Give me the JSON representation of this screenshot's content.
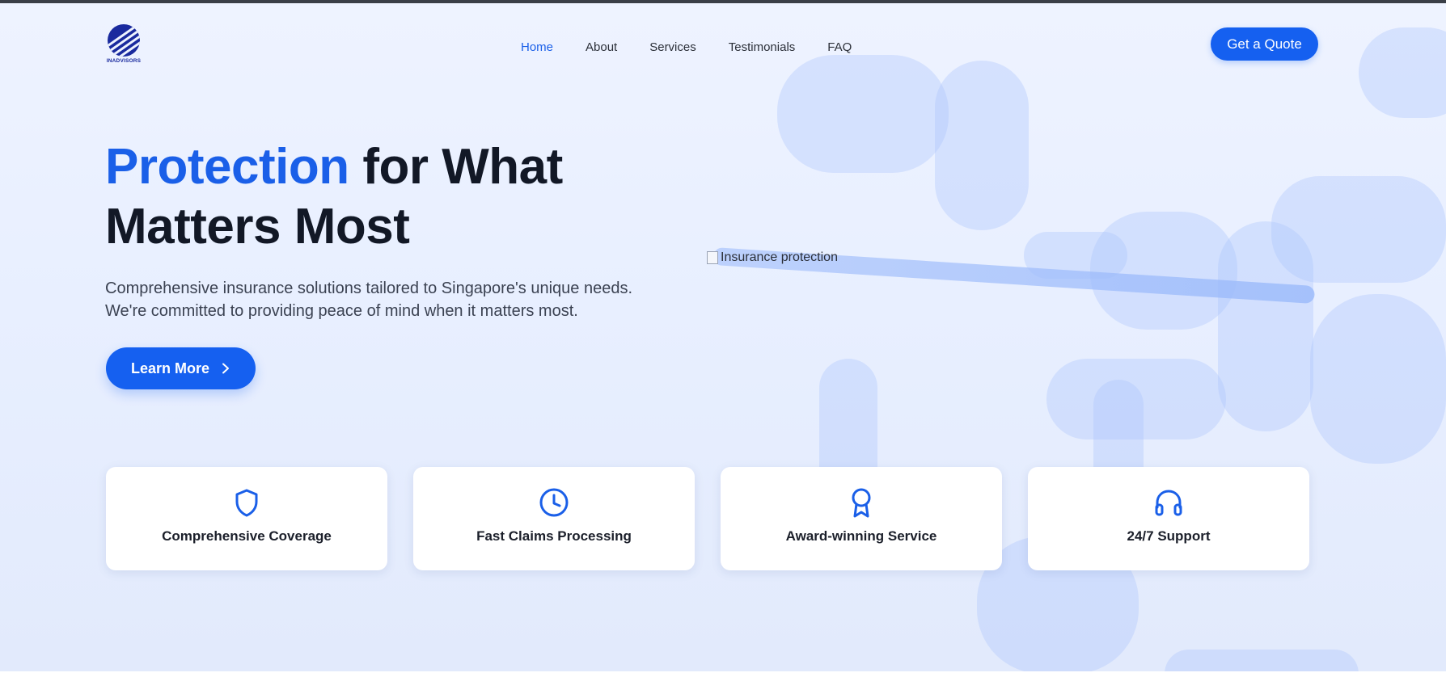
{
  "colors": {
    "accent": "#1a5fe8",
    "button": "#1560f0",
    "heading": "#121826",
    "body_text": "#3b4252",
    "hero_background": "#eef3ff"
  },
  "logo": {
    "text": "INADVISORS",
    "icon": "globe-logo-icon"
  },
  "nav": {
    "items": [
      {
        "label": "Home",
        "active": true
      },
      {
        "label": "About",
        "active": false
      },
      {
        "label": "Services",
        "active": false
      },
      {
        "label": "Testimonials",
        "active": false
      },
      {
        "label": "FAQ",
        "active": false
      }
    ],
    "cta_label": "Get a Quote"
  },
  "hero": {
    "headline_accent": "Protection",
    "headline_line1_rest": " for What",
    "headline_line2": "Matters Most",
    "subtext_line1": "Comprehensive insurance solutions tailored to Singapore's unique needs.",
    "subtext_line2": "We're committed to providing peace of mind when it matters most.",
    "button_label": "Learn More",
    "button_icon": "chevron-right-icon",
    "image_alt": "Insurance protection"
  },
  "features": [
    {
      "title": "Comprehensive Coverage",
      "icon": "shield-icon"
    },
    {
      "title": "Fast Claims Processing",
      "icon": "clock-icon"
    },
    {
      "title": "Award-winning Service",
      "icon": "award-ribbon-icon"
    },
    {
      "title": "24/7 Support",
      "icon": "headphones-icon"
    }
  ]
}
